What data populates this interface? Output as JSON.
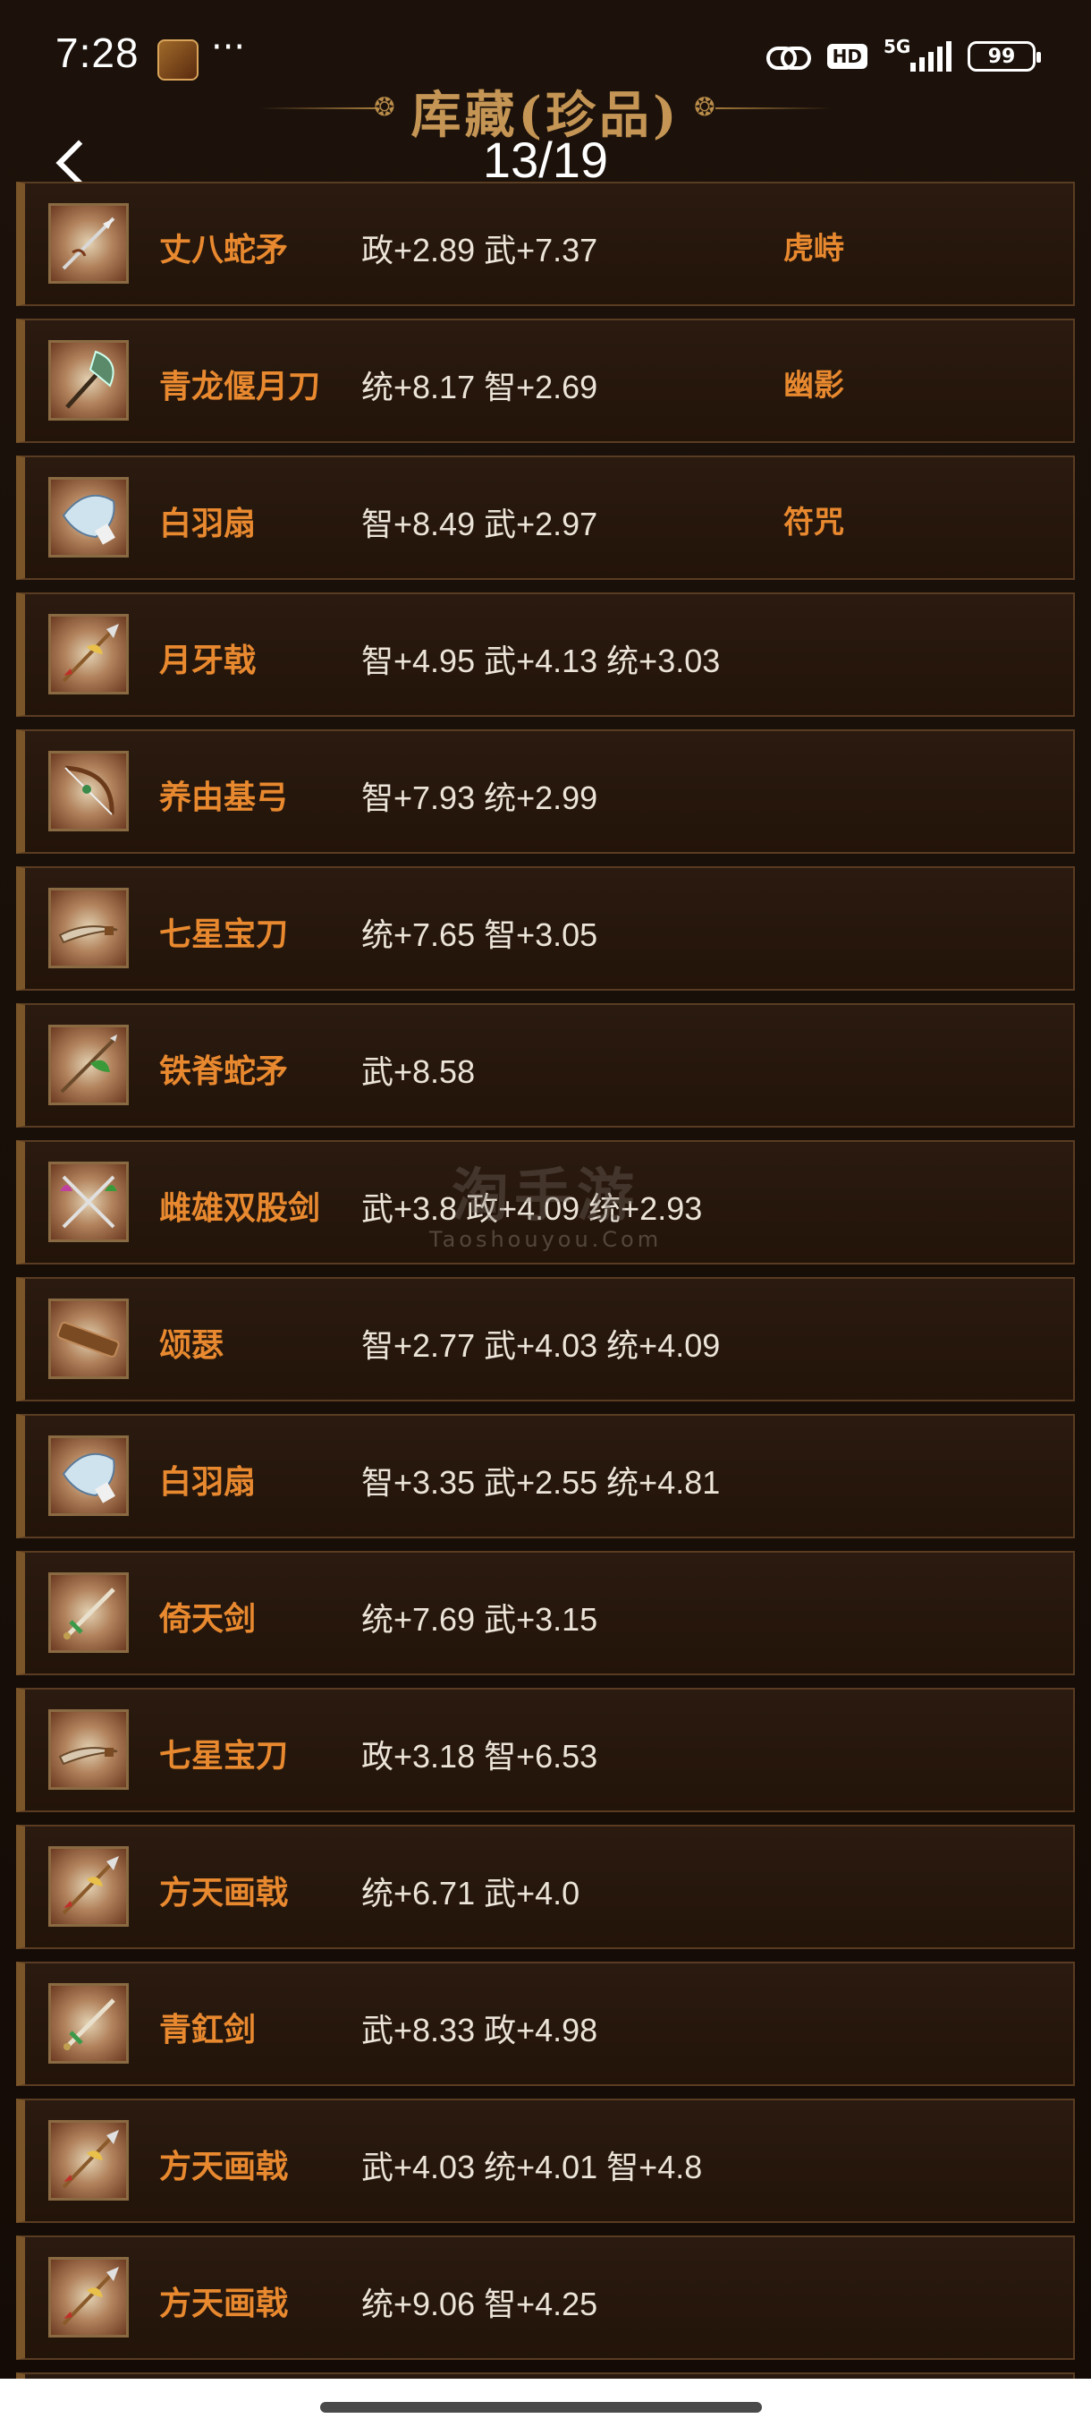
{
  "status_bar": {
    "time": "7:28",
    "more": "···",
    "hd": "HD",
    "network": "5G",
    "battery": "99"
  },
  "header": {
    "title": "库藏(珍品)",
    "counter": "13/19"
  },
  "watermark": {
    "line1": "淘手游",
    "line2": "Taoshouyou.Com"
  },
  "items": [
    {
      "name": "丈八蛇矛",
      "stats": "政+2.89 武+7.37",
      "tag": "虎峙",
      "icon": "spear-icon"
    },
    {
      "name": "青龙偃月刀",
      "stats": "统+8.17 智+2.69",
      "tag": "幽影",
      "icon": "glaive-icon"
    },
    {
      "name": "白羽扇",
      "stats": "智+8.49 武+2.97",
      "tag": "符咒",
      "icon": "fan-icon"
    },
    {
      "name": "月牙戟",
      "stats": "智+4.95 武+4.13 统+3.03",
      "tag": "",
      "icon": "halberd-icon"
    },
    {
      "name": "养由基弓",
      "stats": "智+7.93 统+2.99",
      "tag": "",
      "icon": "bow-icon"
    },
    {
      "name": "七星宝刀",
      "stats": "统+7.65 智+3.05",
      "tag": "",
      "icon": "sabre-icon"
    },
    {
      "name": "铁脊蛇矛",
      "stats": "武+8.58",
      "tag": "",
      "icon": "serpent-spear-icon"
    },
    {
      "name": "雌雄双股剑",
      "stats": "武+3.8 政+4.09 统+2.93",
      "tag": "",
      "icon": "twin-swords-icon"
    },
    {
      "name": "颂瑟",
      "stats": "智+2.77 武+4.03 统+4.09",
      "tag": "",
      "icon": "zither-icon"
    },
    {
      "name": "白羽扇",
      "stats": "智+3.35 武+2.55 统+4.81",
      "tag": "",
      "icon": "fan-icon"
    },
    {
      "name": "倚天剑",
      "stats": "统+7.69 武+3.15",
      "tag": "",
      "icon": "sword-icon"
    },
    {
      "name": "七星宝刀",
      "stats": "政+3.18 智+6.53",
      "tag": "",
      "icon": "sabre-icon"
    },
    {
      "name": "方天画戟",
      "stats": "统+6.71 武+4.0",
      "tag": "",
      "icon": "halberd-icon"
    },
    {
      "name": "青釭剑",
      "stats": "武+8.33 政+4.98",
      "tag": "",
      "icon": "sword-icon"
    },
    {
      "name": "方天画戟",
      "stats": "武+4.03 统+4.01 智+4.8",
      "tag": "",
      "icon": "halberd-icon"
    },
    {
      "name": "方天画戟",
      "stats": "统+9.06 智+4.25",
      "tag": "",
      "icon": "halberd-icon"
    }
  ]
}
